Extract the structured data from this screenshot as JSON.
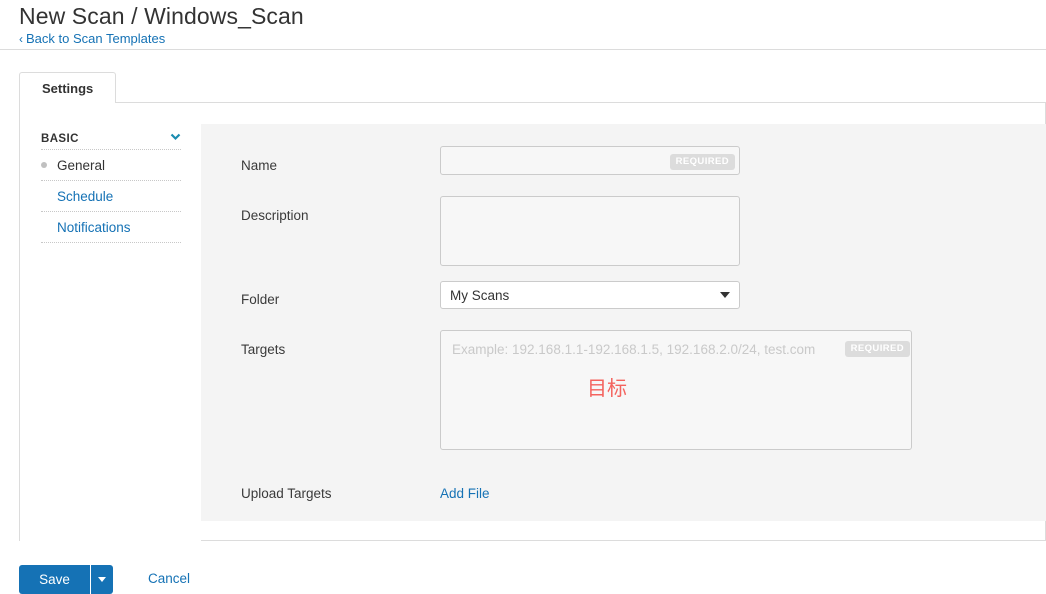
{
  "header": {
    "title": "New Scan / Windows_Scan",
    "back_chevron": "‹",
    "back_label": "Back to Scan Templates"
  },
  "tabs": [
    {
      "label": "Settings",
      "active": true
    }
  ],
  "sidebar": {
    "group_label": "BASIC",
    "group_icon": "chevron-down-icon",
    "items": [
      {
        "label": "General",
        "active": true
      },
      {
        "label": "Schedule",
        "active": false
      },
      {
        "label": "Notifications",
        "active": false
      }
    ]
  },
  "form": {
    "name": {
      "label": "Name",
      "value": "",
      "placeholder": "",
      "required_badge": "REQUIRED"
    },
    "description": {
      "label": "Description",
      "value": "",
      "placeholder": ""
    },
    "folder": {
      "label": "Folder",
      "selected": "My Scans",
      "options": [
        "My Scans"
      ]
    },
    "targets": {
      "label": "Targets",
      "value": "",
      "placeholder": "Example: 192.168.1.1-192.168.1.5, 192.168.2.0/24, test.com",
      "required_badge": "REQUIRED",
      "annotation": "目标"
    },
    "upload_targets": {
      "label": "Upload Targets",
      "link_label": "Add File"
    }
  },
  "footer": {
    "save_label": "Save",
    "save_caret_icon": "caret-down-icon",
    "cancel_label": "Cancel"
  },
  "colors": {
    "accent_blue": "#1572b5",
    "link_blue": "#1572b5",
    "chevron_teal": "#1a8cb0",
    "annotation_red": "#f4635e",
    "panel_gray": "#f4f4f4",
    "border_gray": "#dcdcdc",
    "required_badge_gray": "#dcdcdc"
  }
}
